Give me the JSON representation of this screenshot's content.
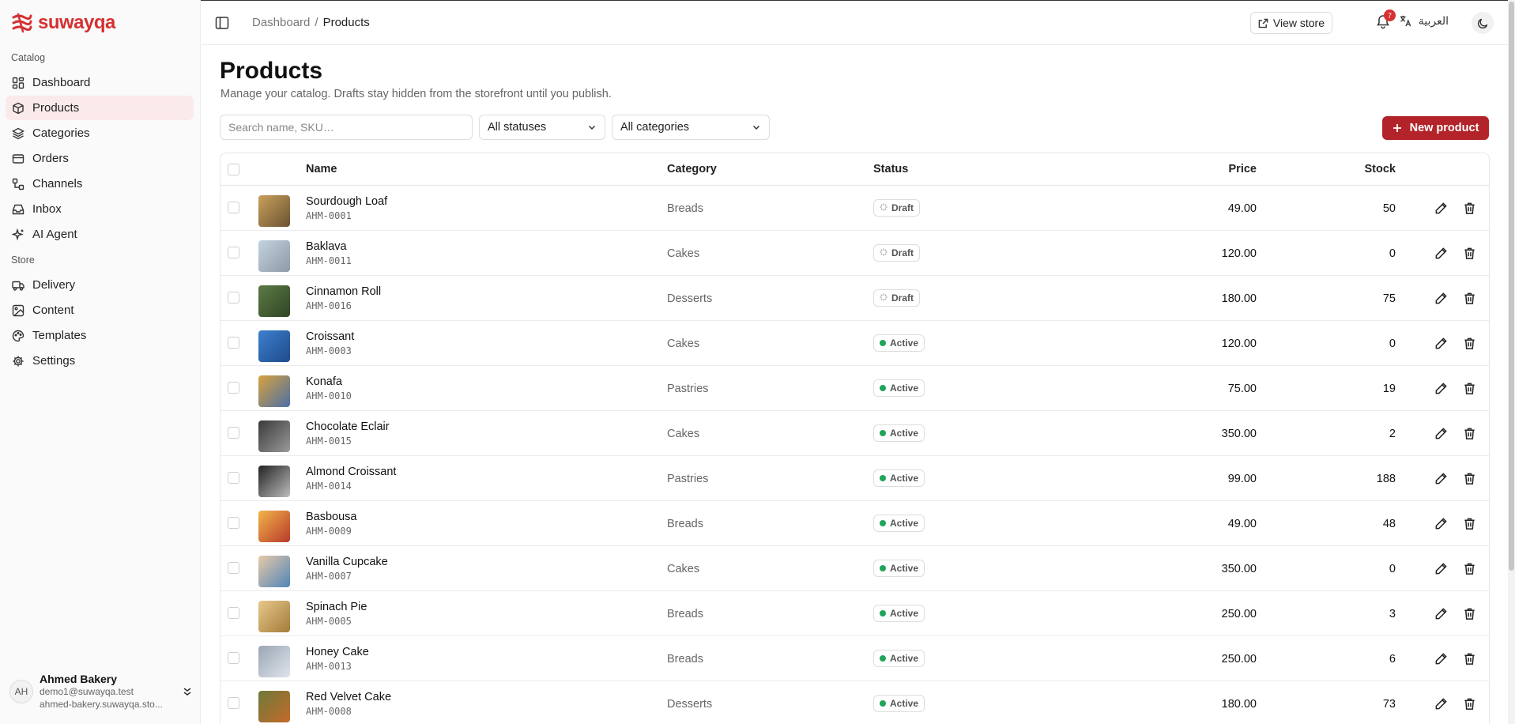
{
  "brand": {
    "name": "suwayqa",
    "color": "#d63031"
  },
  "sidebar": {
    "catalog_label": "Catalog",
    "store_label": "Store",
    "items": [
      {
        "label": "Dashboard",
        "icon": "grid-icon"
      },
      {
        "label": "Products",
        "icon": "box-icon",
        "active": true
      },
      {
        "label": "Categories",
        "icon": "layers-icon"
      },
      {
        "label": "Orders",
        "icon": "card-icon"
      },
      {
        "label": "Channels",
        "icon": "workflow-icon"
      },
      {
        "label": "Inbox",
        "icon": "inbox-icon"
      },
      {
        "label": "AI Agent",
        "icon": "sparkles-icon"
      },
      {
        "label": "Delivery",
        "icon": "truck-icon"
      },
      {
        "label": "Content",
        "icon": "image-icon"
      },
      {
        "label": "Templates",
        "icon": "palette-icon"
      },
      {
        "label": "Settings",
        "icon": "gear-icon"
      }
    ],
    "user": {
      "initials": "AH",
      "name": "Ahmed Bakery",
      "email": "demo1@suwayqa.test",
      "domain": "ahmed-bakery.suwayqa.sto..."
    }
  },
  "header": {
    "breadcrumb": [
      "Dashboard",
      "Products"
    ],
    "view_store": "View store",
    "notifications": "7",
    "language": "العربية"
  },
  "main": {
    "title": "Products",
    "description": "Manage your catalog. Drafts stay hidden from the storefront until you publish.",
    "search_placeholder": "Search name, SKU…",
    "status_filter": "All statuses",
    "category_filter": "All categories",
    "new_button": "New product",
    "columns": {
      "name": "Name",
      "category": "Category",
      "status": "Status",
      "price": "Price",
      "stock": "Stock"
    },
    "rows": [
      {
        "name": "Sourdough Loaf",
        "sku": "AHM-0001",
        "category": "Breads",
        "status": "Draft",
        "price": "49.00",
        "stock": "50",
        "thumb": [
          "#c9a15b",
          "#6b5233"
        ]
      },
      {
        "name": "Baklava",
        "sku": "AHM-0011",
        "category": "Cakes",
        "status": "Draft",
        "price": "120.00",
        "stock": "0",
        "thumb": [
          "#c4d3e0",
          "#8d9aa6"
        ]
      },
      {
        "name": "Cinnamon Roll",
        "sku": "AHM-0016",
        "category": "Desserts",
        "status": "Draft",
        "price": "180.00",
        "stock": "75",
        "thumb": [
          "#5d7a44",
          "#2f4527"
        ]
      },
      {
        "name": "Croissant",
        "sku": "AHM-0003",
        "category": "Cakes",
        "status": "Active",
        "price": "120.00",
        "stock": "0",
        "thumb": [
          "#3e7fcf",
          "#1e4b8a"
        ]
      },
      {
        "name": "Konafa",
        "sku": "AHM-0010",
        "category": "Pastries",
        "status": "Active",
        "price": "75.00",
        "stock": "19",
        "thumb": [
          "#d9a23c",
          "#4b6fa8"
        ]
      },
      {
        "name": "Chocolate Eclair",
        "sku": "AHM-0015",
        "category": "Cakes",
        "status": "Active",
        "price": "350.00",
        "stock": "2",
        "thumb": [
          "#3a3a3a",
          "#9a9a9a"
        ]
      },
      {
        "name": "Almond Croissant",
        "sku": "AHM-0014",
        "category": "Pastries",
        "status": "Active",
        "price": "99.00",
        "stock": "188",
        "thumb": [
          "#222222",
          "#bdbdbd"
        ]
      },
      {
        "name": "Basbousa",
        "sku": "AHM-0009",
        "category": "Breads",
        "status": "Active",
        "price": "49.00",
        "stock": "48",
        "thumb": [
          "#f2b44a",
          "#b83a2a"
        ]
      },
      {
        "name": "Vanilla Cupcake",
        "sku": "AHM-0007",
        "category": "Cakes",
        "status": "Active",
        "price": "350.00",
        "stock": "0",
        "thumb": [
          "#e8c9a8",
          "#4f86b8"
        ]
      },
      {
        "name": "Spinach Pie",
        "sku": "AHM-0005",
        "category": "Breads",
        "status": "Active",
        "price": "250.00",
        "stock": "3",
        "thumb": [
          "#e7c98a",
          "#a37a3a"
        ]
      },
      {
        "name": "Honey Cake",
        "sku": "AHM-0013",
        "category": "Breads",
        "status": "Active",
        "price": "250.00",
        "stock": "6",
        "thumb": [
          "#9aa6b6",
          "#dfe4ea"
        ]
      },
      {
        "name": "Red Velvet Cake",
        "sku": "AHM-0008",
        "category": "Desserts",
        "status": "Active",
        "price": "180.00",
        "stock": "73",
        "thumb": [
          "#6e7a3a",
          "#c46a2a"
        ]
      }
    ]
  },
  "colors": {
    "accent": "#b3242a",
    "active_bg": "#fbeaea",
    "success": "#1fa45c"
  }
}
